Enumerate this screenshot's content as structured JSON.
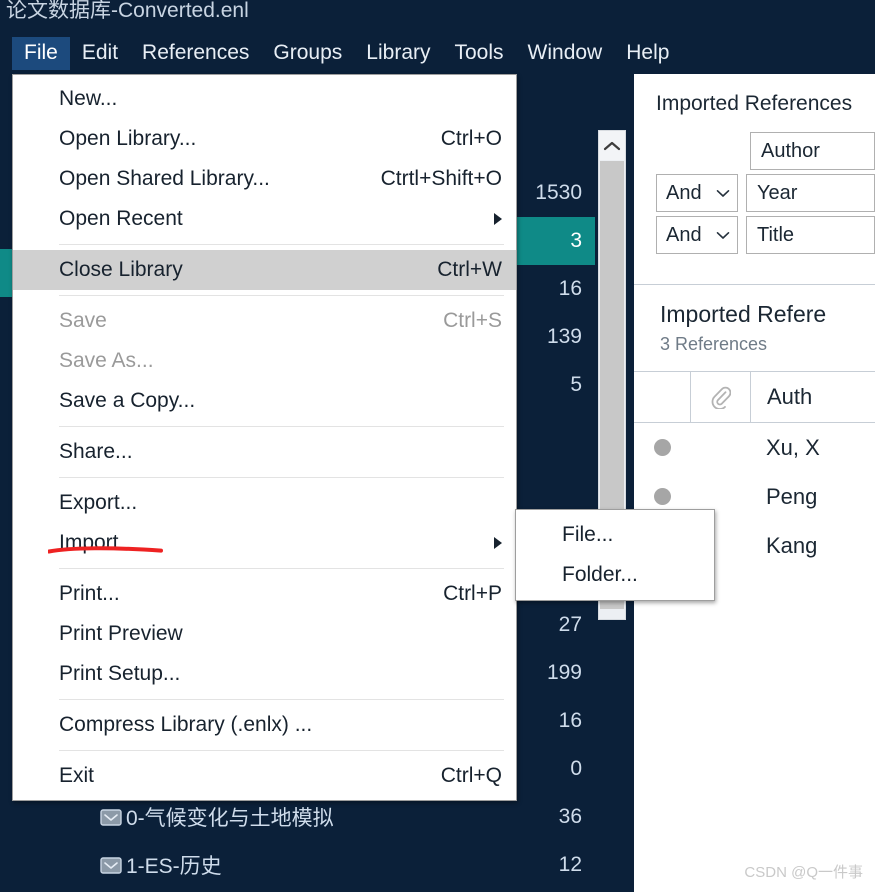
{
  "window": {
    "title": "论文数据库-Converted.enl"
  },
  "menu_bar": {
    "items": [
      {
        "label": "File",
        "active": true
      },
      {
        "label": "Edit",
        "active": false
      },
      {
        "label": "References",
        "active": false
      },
      {
        "label": "Groups",
        "active": false
      },
      {
        "label": "Library",
        "active": false
      },
      {
        "label": "Tools",
        "active": false
      },
      {
        "label": "Window",
        "active": false
      },
      {
        "label": "Help",
        "active": false
      }
    ]
  },
  "file_menu": {
    "items": [
      {
        "label": "New...",
        "accel": "",
        "state": "normal",
        "submenu": false,
        "sep_after": false
      },
      {
        "label": "Open Library...",
        "accel": "Ctrl+O",
        "state": "normal",
        "submenu": false,
        "sep_after": false
      },
      {
        "label": "Open Shared Library...",
        "accel": "Ctrtl+Shift+O",
        "state": "normal",
        "submenu": false,
        "sep_after": false
      },
      {
        "label": "Open Recent",
        "accel": "",
        "state": "normal",
        "submenu": true,
        "sep_after": true
      },
      {
        "label": "Close Library",
        "accel": "Ctrl+W",
        "state": "highlight",
        "submenu": false,
        "sep_after": true
      },
      {
        "label": "Save",
        "accel": "Ctrl+S",
        "state": "disabled",
        "submenu": false,
        "sep_after": false
      },
      {
        "label": "Save As...",
        "accel": "",
        "state": "disabled",
        "submenu": false,
        "sep_after": false
      },
      {
        "label": "Save a Copy...",
        "accel": "",
        "state": "normal",
        "submenu": false,
        "sep_after": true
      },
      {
        "label": "Share...",
        "accel": "",
        "state": "normal",
        "submenu": false,
        "sep_after": true
      },
      {
        "label": "Export...",
        "accel": "",
        "state": "normal",
        "submenu": false,
        "sep_after": false
      },
      {
        "label": "Import",
        "accel": "",
        "state": "normal",
        "submenu": true,
        "sep_after": true
      },
      {
        "label": "Print...",
        "accel": "Ctrl+P",
        "state": "normal",
        "submenu": false,
        "sep_after": false
      },
      {
        "label": "Print Preview",
        "accel": "",
        "state": "normal",
        "submenu": false,
        "sep_after": false
      },
      {
        "label": "Print Setup...",
        "accel": "",
        "state": "normal",
        "submenu": false,
        "sep_after": true
      },
      {
        "label": "Compress Library (.enlx) ...",
        "accel": "",
        "state": "normal",
        "submenu": false,
        "sep_after": true
      },
      {
        "label": "Exit",
        "accel": "Ctrl+Q",
        "state": "normal",
        "submenu": false,
        "sep_after": false
      }
    ]
  },
  "import_submenu": {
    "items": [
      {
        "label": "File...",
        "annotated": true
      },
      {
        "label": "Folder...",
        "annotated": false
      }
    ],
    "annotation_color": "#ee2222"
  },
  "tree_panel": {
    "rows": [
      {
        "label": "",
        "count": "",
        "selected": false
      },
      {
        "label": "",
        "count": "",
        "selected": false
      },
      {
        "label": "",
        "count": "1530",
        "selected": false
      },
      {
        "label": "",
        "count": "3",
        "selected": true
      },
      {
        "label": "",
        "count": "16",
        "selected": false
      },
      {
        "label": "",
        "count": "139",
        "selected": false
      },
      {
        "label": "",
        "count": "5",
        "selected": false
      },
      {
        "label": "",
        "count": "",
        "selected": false
      },
      {
        "label": "",
        "count": "",
        "selected": false
      },
      {
        "label": "",
        "count": "",
        "selected": false
      },
      {
        "label": "",
        "count": "",
        "selected": false
      },
      {
        "label": "",
        "count": "27",
        "selected": false
      },
      {
        "label": "",
        "count": "199",
        "selected": false
      },
      {
        "label": "",
        "count": "16",
        "selected": false
      },
      {
        "label": "",
        "count": "0",
        "selected": false
      },
      {
        "label": "0-气候变化与土地模拟",
        "count": "36",
        "selected": false
      },
      {
        "label": "1-ES-历史",
        "count": "12",
        "selected": false
      }
    ]
  },
  "right_panel": {
    "header_title": "Imported References",
    "search": {
      "rows": [
        {
          "bool": "",
          "field": "Author"
        },
        {
          "bool": "And",
          "field": "Year"
        },
        {
          "bool": "And",
          "field": "Title"
        }
      ]
    },
    "section": {
      "title": "Imported Refere",
      "subtitle": "3 References"
    },
    "table": {
      "columns": [
        {
          "key": "dot",
          "label": ""
        },
        {
          "key": "clip",
          "label": ""
        },
        {
          "key": "auth",
          "label": "Auth"
        }
      ],
      "rows": [
        {
          "author": "Xu, X"
        },
        {
          "author": "Peng"
        },
        {
          "author": "Kang"
        }
      ]
    }
  },
  "watermark": {
    "text": "CSDN @Q一件事"
  },
  "colors": {
    "chrome_bg": "#0b2039",
    "menu_highlight": "#d0d0d0",
    "selection_teal": "#0f8a87",
    "menubar_active": "#1c4a7d",
    "annotation_red": "#ee2222"
  }
}
